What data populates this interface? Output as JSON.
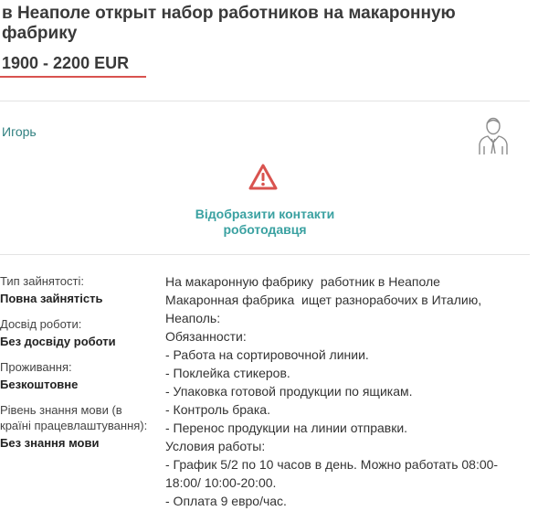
{
  "job": {
    "title": "в Неаполе открыт набор работников на макаронную фабрику",
    "salary": "1900 - 2200 EUR"
  },
  "employer": {
    "name": "Игорь",
    "avatar_icon": "person-icon",
    "warning_icon": "warning-icon",
    "show_contacts_label": "Відобразити контакти роботодавця"
  },
  "properties": [
    {
      "label": "Тип зайнятості:",
      "value": "Повна зайнятість"
    },
    {
      "label": "Досвід роботи:",
      "value": "Без досвіду роботи"
    },
    {
      "label": "Проживання:",
      "value": "Безкоштовне"
    },
    {
      "label": "Рівень знання мови (в країні працевлаштування):",
      "value": "Без знання мови"
    }
  ],
  "description": {
    "lines": [
      "На макаронную фабрику  работник в Неаполе",
      "Макаронная фабрика  ищет разнорабочих в Италию,",
      "Неаполь:",
      "Обязанности:",
      "- Работа на сортировочной линии.",
      "- Поклейка стикеров.",
      "- Упаковка готовой продукции по ящикам.",
      "- Контроль брака.",
      "- Перенос продукции на линии отправки.",
      "Условия работы:",
      "- График 5/2 по 10 часов в день. Можно работать 08:00-",
      "18:00/ 10:00-20:00.",
      "- Оплата 9 евро/час."
    ]
  },
  "colors": {
    "accent_teal": "#3aa1a1",
    "warning_red": "#d9534f"
  }
}
